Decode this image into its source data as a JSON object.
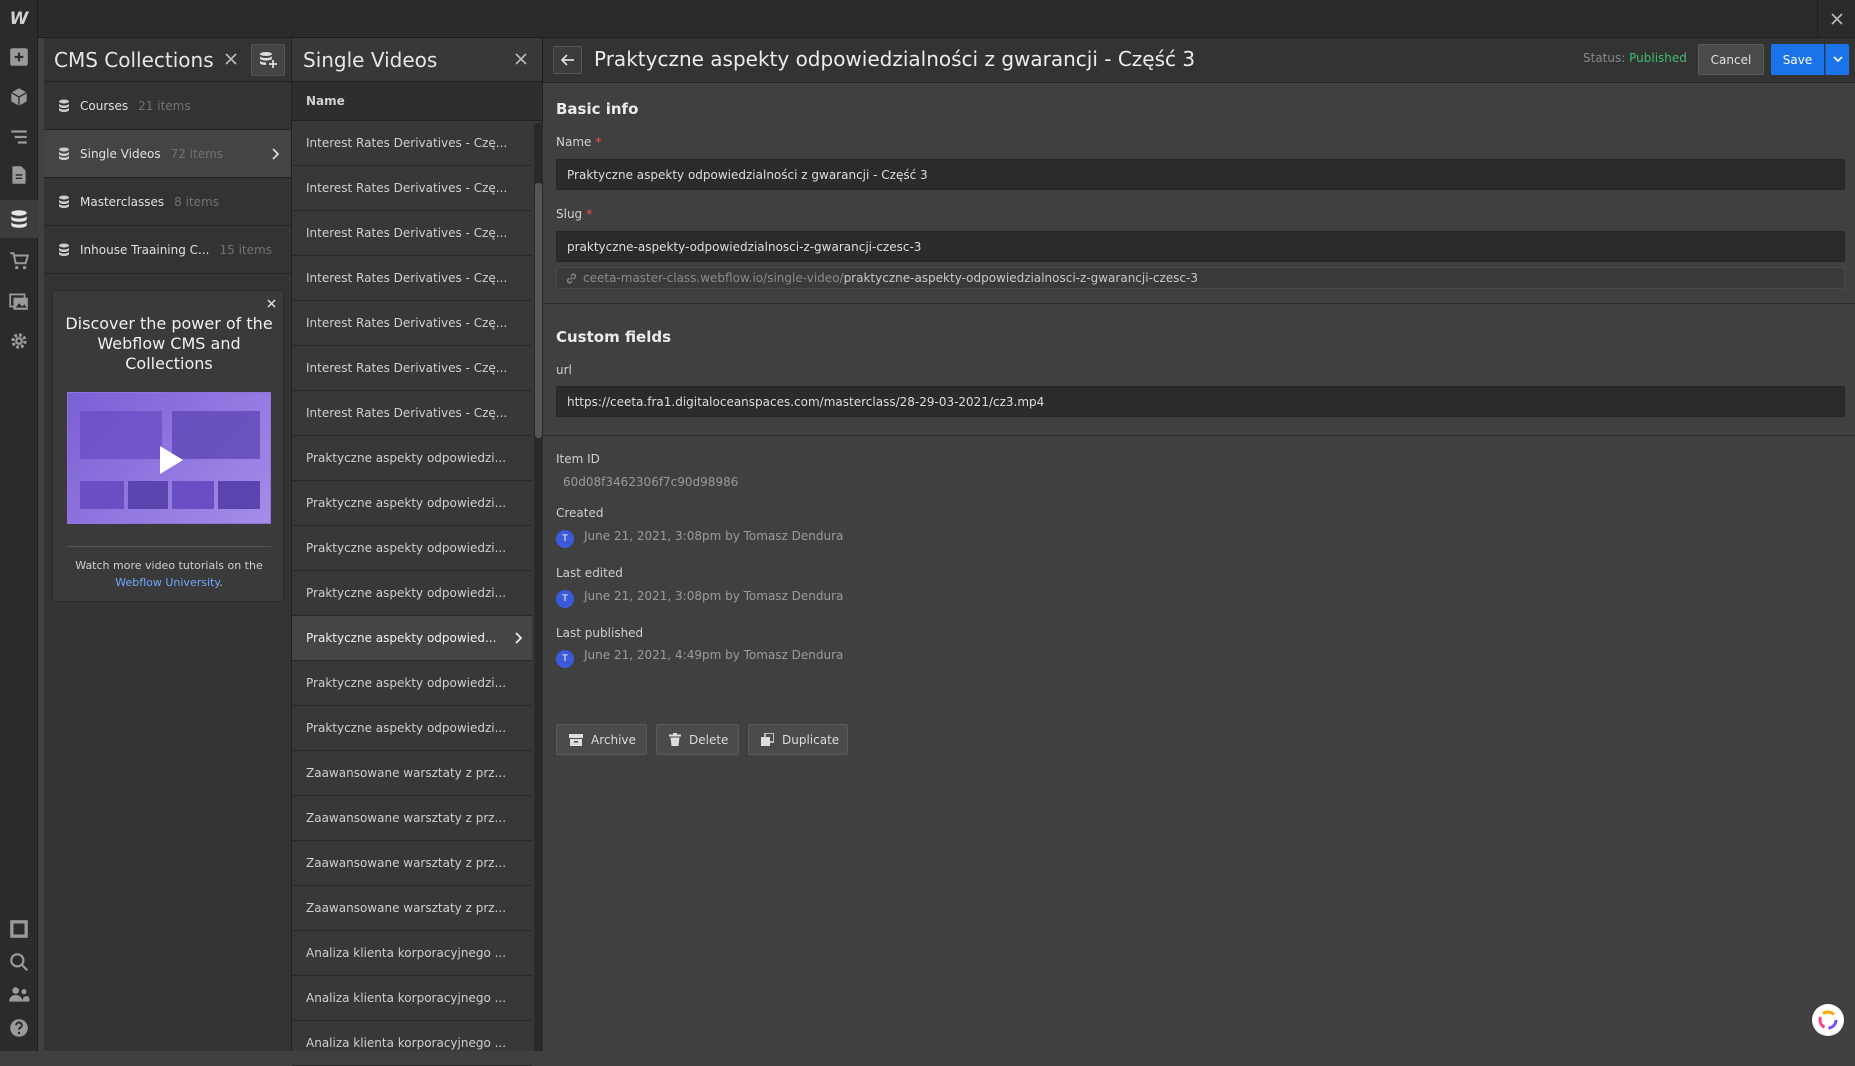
{
  "app": {
    "logo": "W"
  },
  "rail": {
    "top_icons": [
      "add-icon",
      "box-icon",
      "navigator-icon",
      "pages-icon",
      "cms-icon",
      "ecommerce-icon",
      "assets-icon",
      "settings-icon"
    ],
    "bottom_icons": [
      "preview-icon",
      "search-icon",
      "users-icon",
      "help-icon"
    ]
  },
  "collections_panel": {
    "title": "CMS Collections",
    "items": [
      {
        "name": "Courses",
        "count": "21 items"
      },
      {
        "name": "Single Videos",
        "count": "72 items"
      },
      {
        "name": "Masterclasses",
        "count": "8 items"
      },
      {
        "name": "Inhouse Traaining C...",
        "count": "15 items"
      }
    ],
    "promo": {
      "title": "Discover the power of the Webflow CMS and Collections",
      "text": "Watch more video tutorials on the",
      "link": "Webflow University",
      "suffix": "."
    }
  },
  "videos_panel": {
    "title": "Single Videos",
    "column": "Name",
    "rows": [
      "Interest Rates Derivatives - Czę...",
      "Interest Rates Derivatives - Czę...",
      "Interest Rates Derivatives - Czę...",
      "Interest Rates Derivatives - Czę...",
      "Interest Rates Derivatives - Czę...",
      "Interest Rates Derivatives - Czę...",
      "Interest Rates Derivatives - Czę...",
      "Praktyczne aspekty odpowiedzi...",
      "Praktyczne aspekty odpowiedzi...",
      "Praktyczne aspekty odpowiedzi...",
      "Praktyczne aspekty odpowiedzi...",
      "Praktyczne aspekty odpowied...",
      "Praktyczne aspekty odpowiedzi...",
      "Praktyczne aspekty odpowiedzi...",
      "Zaawansowane warsztaty z prz...",
      "Zaawansowane warsztaty z prz...",
      "Zaawansowane warsztaty z prz...",
      "Zaawansowane warsztaty z prz...",
      "Analiza klienta korporacyjnego ...",
      "Analiza klienta korporacyjnego ...",
      "Analiza klienta korporacyjnego ..."
    ]
  },
  "editor": {
    "title": "Praktyczne aspekty odpowiedzialności z gwarancji - Część 3",
    "status_label": "Status:",
    "status_value": "Published",
    "cancel": "Cancel",
    "save": "Save",
    "basic_info": "Basic info",
    "name_label": "Name",
    "name_value": "Praktyczne aspekty odpowiedzialności z gwarancji - Część 3",
    "slug_label": "Slug",
    "slug_value": "praktyczne-aspekty-odpowiedzialnosci-z-gwarancji-czesc-3",
    "url_base": "ceeta-master-class.webflow.io/single-video/",
    "url_slug": "praktyczne-aspekty-odpowiedzialnosci-z-gwarancji-czesc-3",
    "custom_fields": "Custom fields",
    "url_label": "url",
    "url_value": "https://ceeta.fra1.digitaloceanspaces.com/masterclass/28-29-03-2021/cz3.mp4",
    "item_id_label": "Item ID",
    "item_id_value": "60d08f3462306f7c90d98986",
    "created_label": "Created",
    "created_value": "June 21, 2021, 3:08pm by Tomasz Dendura",
    "edited_label": "Last edited",
    "edited_value": "June 21, 2021, 3:08pm by Tomasz Dendura",
    "published_label": "Last published",
    "published_value": "June 21, 2021, 4:49pm by Tomasz Dendura",
    "avatar_initial": "T",
    "archive": "Archive",
    "delete": "Delete",
    "duplicate": "Duplicate"
  },
  "colors": {
    "accent": "#1a73e8",
    "published": "#3fbf6f",
    "required": "#ff4c4c"
  }
}
